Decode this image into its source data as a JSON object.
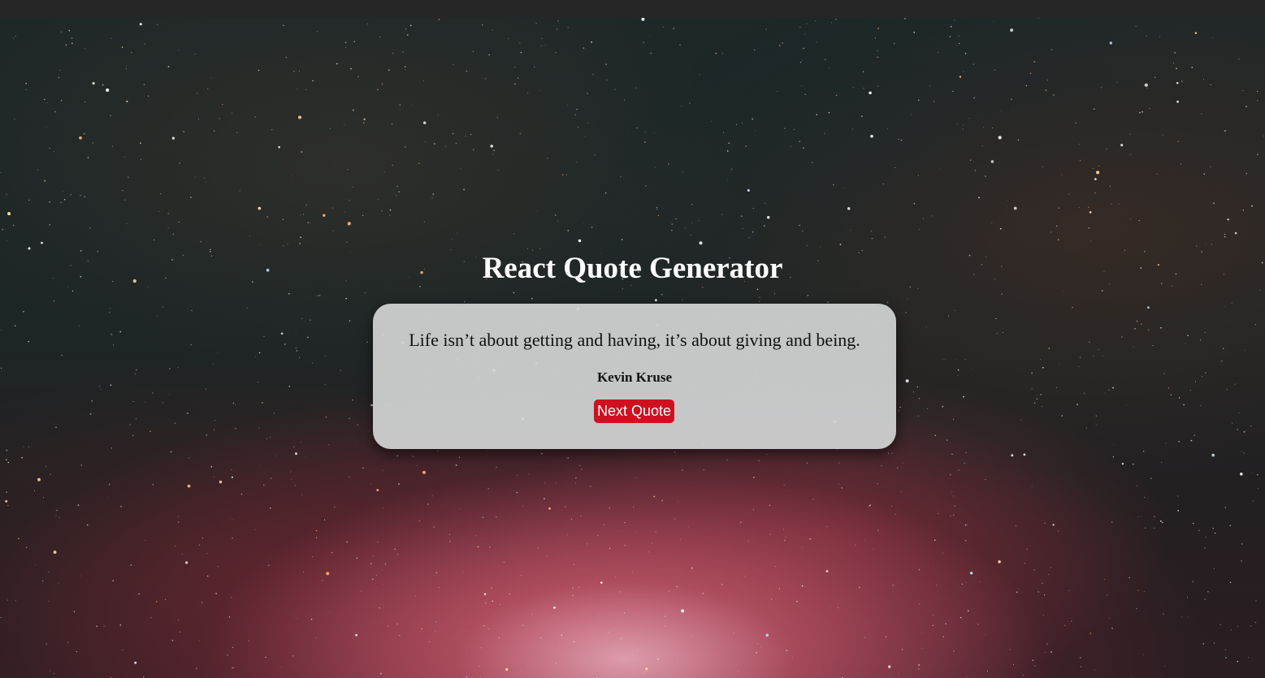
{
  "page": {
    "title": "React Quote Generator"
  },
  "quote": {
    "text": "Life isn’t about getting and having, it’s about giving and being.",
    "author": "Kevin Kruse"
  },
  "actions": {
    "next_label": "Next Quote"
  },
  "colors": {
    "button_background": "#cf1020",
    "card_background": "#d2d4d4",
    "title_text": "#ffffff"
  }
}
